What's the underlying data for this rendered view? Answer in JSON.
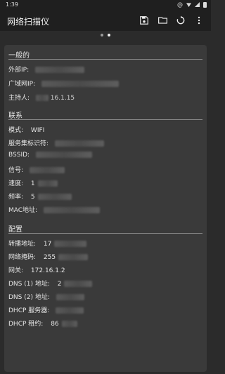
{
  "status": {
    "time": "1:39",
    "at_symbol": "@"
  },
  "appbar": {
    "title": "网络扫描仪"
  },
  "sections": {
    "general": {
      "title": "一般的",
      "external_ip_label": "外部IP:",
      "wan_ip_label": "广域网IP:",
      "host_label": "主持人:",
      "host_value": "16.1.15"
    },
    "connection": {
      "title": "联系",
      "mode_label": "模式:",
      "mode_value": "WIFI",
      "ssid_label": "服务集标识符:",
      "bssid_label": "BSSID:",
      "signal_label": "信号:",
      "speed_label": "速度:",
      "speed_value": "1",
      "freq_label": "频率:",
      "freq_value": "5",
      "mac_label": "MAC地址:"
    },
    "config": {
      "title": "配置",
      "forward_label": "转播地址:",
      "forward_value": "17",
      "mask_label": "网络掩码:",
      "mask_value": "255",
      "gateway_label": "网关:",
      "gateway_value": "172.16.1.2",
      "dns1_label": "DNS (1) 地址:",
      "dns1_value": "2",
      "dns2_label": "DNS (2) 地址:",
      "dhcp_label": "DHCP 服务器:",
      "lease_label": "DHCP 租约:",
      "lease_value": "86"
    }
  }
}
